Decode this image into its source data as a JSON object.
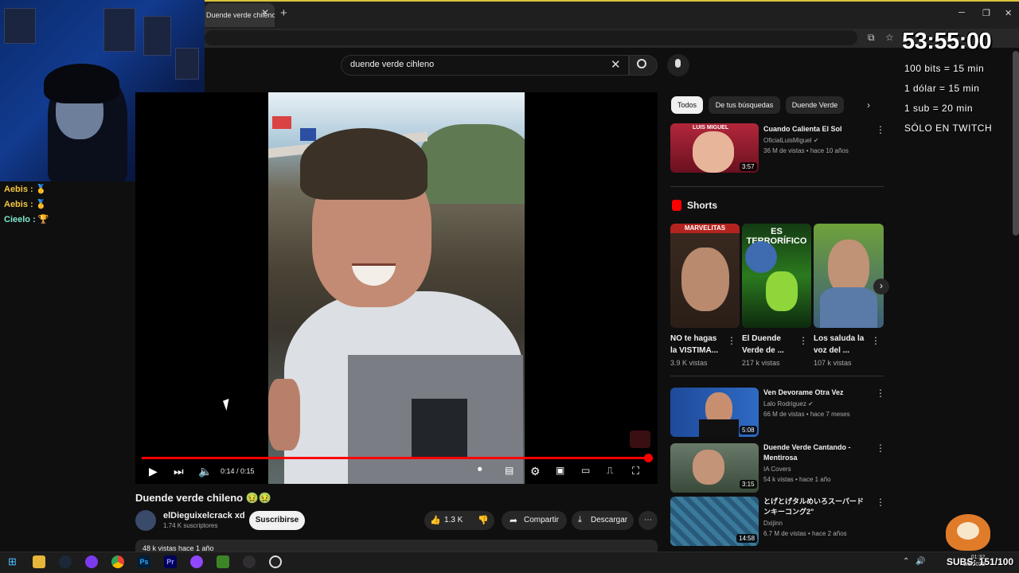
{
  "browser": {
    "tab_title": "Duende verde chileno 🤢🤢",
    "tab_close": "✕",
    "new_tab": "+",
    "minimize": "─",
    "restore": "❐",
    "close": "✕"
  },
  "chat": {
    "messages": [
      {
        "user": "Aebis :",
        "msg": "🥇"
      },
      {
        "user": "Aebis :",
        "msg": "🥇"
      },
      {
        "user": "Cieelo :",
        "msg": "🏆"
      }
    ]
  },
  "search": {
    "query": "duende verde cihleno",
    "clear": "✕"
  },
  "player": {
    "time": "0:14 / 0:15",
    "progress": 0.99
  },
  "video": {
    "title": "Duende verde chileno 🤢🤢",
    "channel": "elDieguixelcrack xd",
    "subscribers": "1.74 K suscriptores",
    "subscribe_label": "Suscribirse",
    "likes": "1.3 K",
    "share_label": "Compartir",
    "download_label": "Descargar",
    "description_preview": "48 k vistas hace 1 año"
  },
  "chips": [
    "Todos",
    "De tus búsquedas",
    "Duende Verde"
  ],
  "related": [
    {
      "title": "Cuando Calienta El Sol",
      "channel": "OficialLuisMiguel",
      "meta": "36 M de vistas • hace 10 años",
      "duration": "3:57",
      "thumb_text": "LUIS MIGUEL"
    },
    {
      "title": "Ven Devorame Otra Vez",
      "channel": "Lalo Rodriguez",
      "meta": "66 M de vistas • hace 7 meses",
      "duration": "5:08",
      "thumb_text": ""
    },
    {
      "title_line1": "Duende Verde Cantando -",
      "title_line2": "Mentirosa",
      "channel": "IA Covers",
      "meta": "54 k vistas • hace 1 año",
      "duration": "3:15"
    },
    {
      "title_line1": "とげとげタルめいろスーパード",
      "title_line2": "ンキーコング2\"",
      "channel": "Dxijinn",
      "meta": "6.7 M de vistas • hace 2 años",
      "duration": "14:58"
    }
  ],
  "shorts": {
    "heading": "Shorts",
    "items": [
      {
        "line1": "NO te hagas",
        "line2": "la VISTIMA...",
        "views": "3.9 K vistas",
        "thumb_text": "MARVELITAS"
      },
      {
        "line1": "El Duende",
        "line2": "Verde de ...",
        "views": "217 k vistas",
        "thumb_text": "ES TERRORÍFICO"
      },
      {
        "line1": "Los saluda la",
        "line2": "voz del ...",
        "views": "107 k vistas",
        "thumb_text": ""
      }
    ]
  },
  "overlay": {
    "timer": "53:55:00",
    "rules": [
      "100 bits = 15 min",
      "1 dólar = 15 min",
      "1 sub = 20 min",
      "SÓLO EN TWITCH"
    ],
    "subs_counter": "SUBS: 151/100"
  },
  "taskbar": {
    "time": "01:32",
    "date": "8/8/2023"
  }
}
